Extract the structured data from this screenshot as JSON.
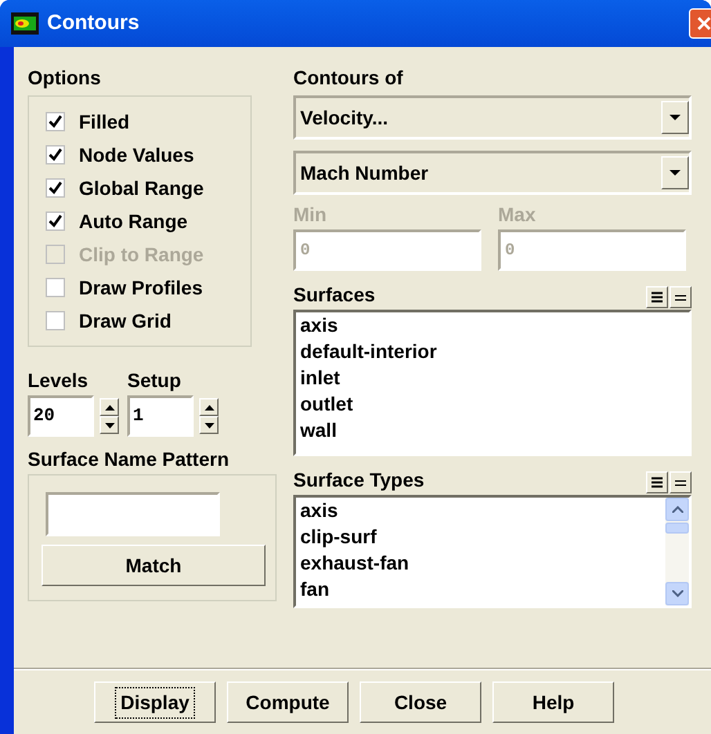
{
  "window": {
    "title": "Contours"
  },
  "options": {
    "title": "Options",
    "items": [
      {
        "label": "Filled",
        "checked": true,
        "disabled": false
      },
      {
        "label": "Node Values",
        "checked": true,
        "disabled": false
      },
      {
        "label": "Global Range",
        "checked": true,
        "disabled": false
      },
      {
        "label": "Auto Range",
        "checked": true,
        "disabled": false
      },
      {
        "label": "Clip to Range",
        "checked": false,
        "disabled": true
      },
      {
        "label": "Draw Profiles",
        "checked": false,
        "disabled": false
      },
      {
        "label": "Draw Grid",
        "checked": false,
        "disabled": false
      }
    ]
  },
  "spinners": [
    {
      "label": "Levels",
      "value": "20"
    },
    {
      "label": "Setup",
      "value": "1"
    }
  ],
  "pattern": {
    "title": "Surface Name Pattern",
    "button": "Match"
  },
  "contours_of": {
    "title": "Contours of",
    "dropdowns": [
      "Velocity...",
      "Mach Number"
    ]
  },
  "range": [
    {
      "label": "Min",
      "value": "0",
      "disabled": true
    },
    {
      "label": "Max",
      "value": "0",
      "disabled": true
    }
  ],
  "surfaces": {
    "title": "Surfaces",
    "items": [
      "axis",
      "default-interior",
      "inlet",
      "outlet",
      "wall"
    ],
    "scrollbar": false
  },
  "surface_types": {
    "title": "Surface Types",
    "items": [
      "axis",
      "clip-surf",
      "exhaust-fan",
      "fan"
    ],
    "scrollbar": true
  },
  "buttons": [
    {
      "label": "Display",
      "focused": true
    },
    {
      "label": "Compute",
      "focused": false
    },
    {
      "label": "Close",
      "focused": false
    },
    {
      "label": "Help",
      "focused": false
    }
  ]
}
